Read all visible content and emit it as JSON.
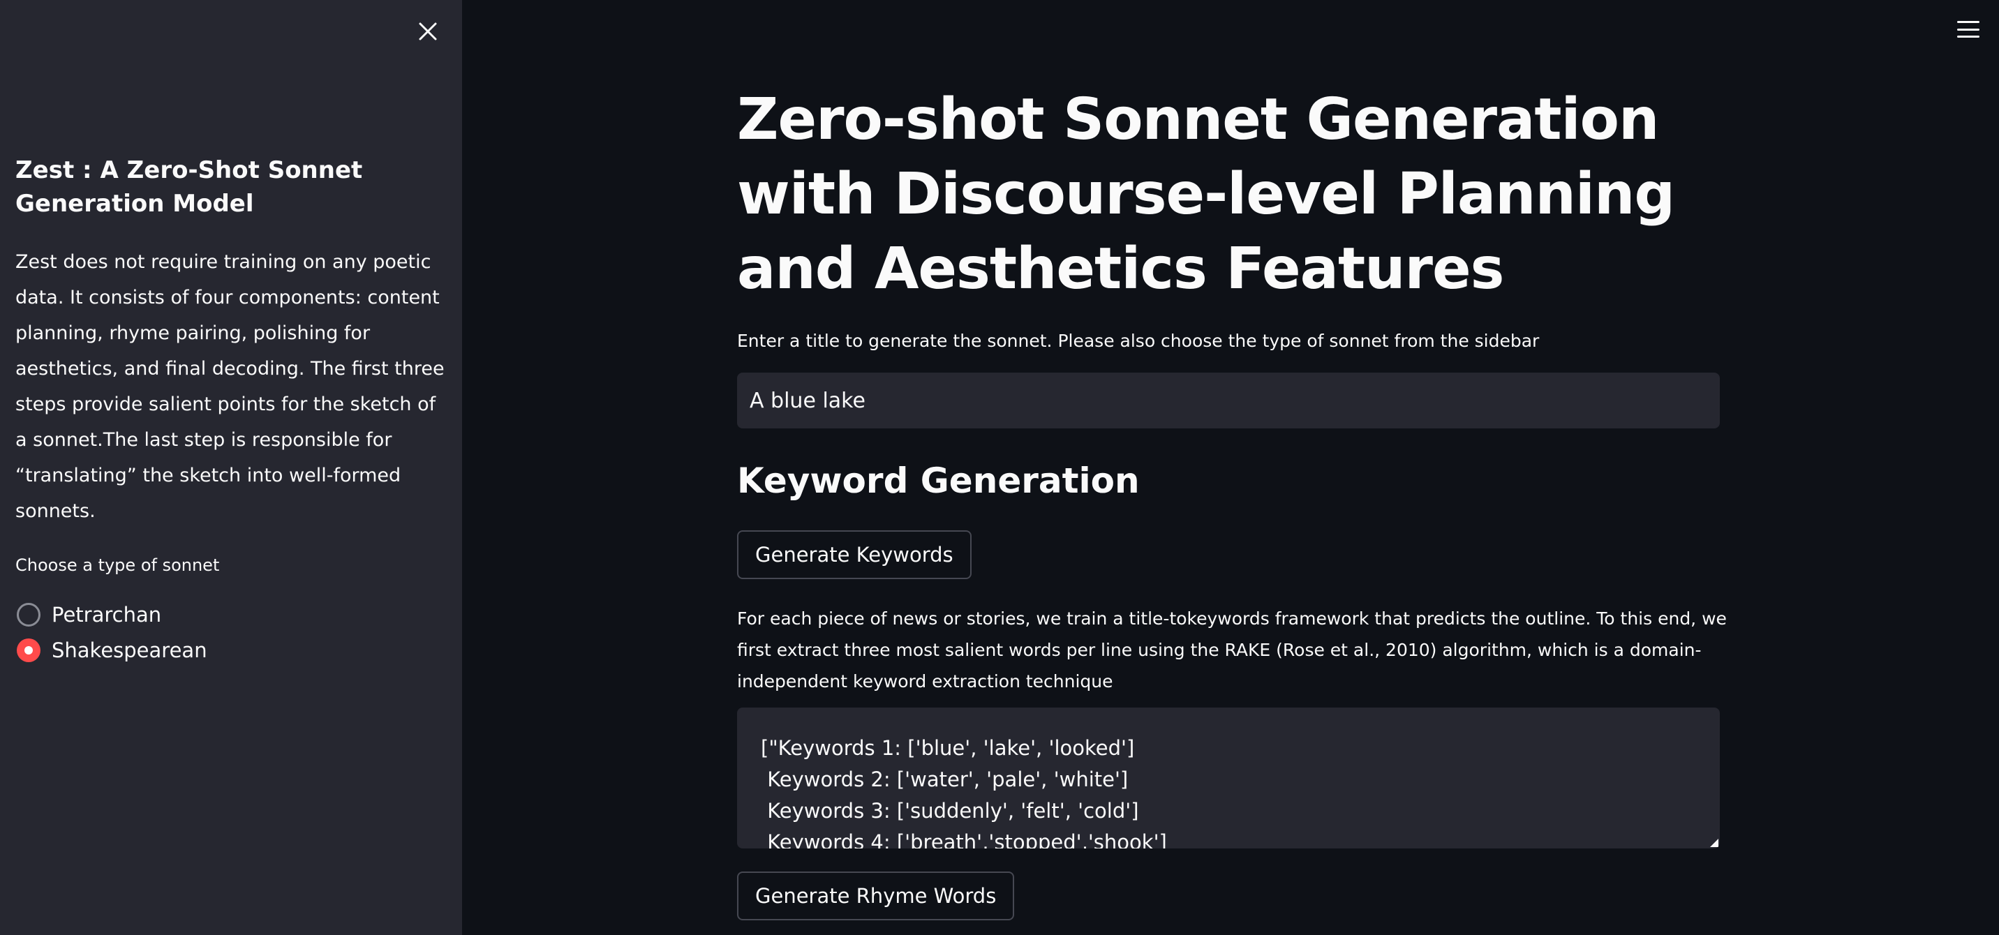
{
  "sidebar": {
    "title": "Zest : A Zero-Shot Sonnet Generation Model",
    "description": "Zest does not require training on any poetic data. It consists of four components: content planning, rhyme pairing, polishing for aesthetics, and final decoding. The first three steps provide salient points for the sketch of a sonnet.The last step is responsible for “translating” the sketch into well-formed sonnets.",
    "radio_label": "Choose a type of sonnet",
    "options": [
      {
        "label": "Petrarchan",
        "selected": false
      },
      {
        "label": "Shakespearean",
        "selected": true
      }
    ],
    "accent_color": "#ff4b4b"
  },
  "main": {
    "title": "Zero-shot Sonnet Generation with Discourse-level Planning and Aesthetics Features",
    "instruction": "Enter a title to generate the sonnet. Please also choose the type of sonnet from the sidebar",
    "title_input_value": "A blue lake",
    "keyword_section_header": "Keyword Generation",
    "generate_keywords_label": "Generate Keywords",
    "explanation": "For each piece of news or stories, we train a title-tokeywords framework that predicts the outline. To this end, we first extract three most salient words per line using the RAKE (Rose et al., 2010) algorithm, which is a domain-independent keyword extraction technique",
    "keywords_lines": [
      "[\"Keywords 1: ['blue', 'lake', 'looked']",
      " Keywords 2: ['water', 'pale', 'white']",
      " Keywords 3: ['suddenly', 'felt', 'cold']",
      " Keywords 4: ['breath','stopped','shook']"
    ],
    "generate_rhyme_label": "Generate Rhyme Words"
  },
  "icons": {
    "close": "close-icon",
    "menu": "hamburger-menu-icon"
  },
  "colors": {
    "background": "#0e1117",
    "sidebar": "#262730",
    "text": "#fafafa"
  }
}
